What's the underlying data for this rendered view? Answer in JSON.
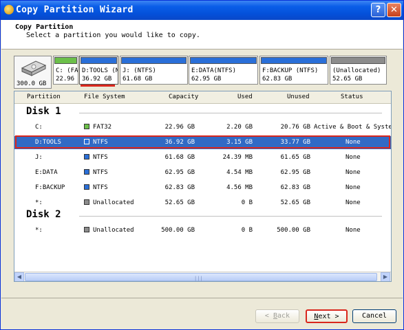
{
  "window": {
    "title": "Copy Partition Wizard"
  },
  "header": {
    "title": "Copy Partition",
    "subtitle": "Select a partition you would like to copy."
  },
  "disk_map": {
    "disk_size": "300.0 GB",
    "partitions": [
      {
        "name": "C: (FA'",
        "size": "22.96",
        "bar_color": "#6cc04a"
      },
      {
        "name": "D:TOOLS (NT",
        "size": "36.92 GB",
        "bar_color": "#2a6fd8"
      },
      {
        "name": "J: (NTFS)",
        "size": "61.68 GB",
        "bar_color": "#2a6fd8"
      },
      {
        "name": "E:DATA(NTFS)",
        "size": "62.95 GB",
        "bar_color": "#2a6fd8"
      },
      {
        "name": "F:BACKUP (NTFS)",
        "size": "62.83 GB",
        "bar_color": "#2a6fd8"
      },
      {
        "name": "(Unallocated)",
        "size": "52.65 GB",
        "bar_color": "#8c8c8c"
      }
    ]
  },
  "table": {
    "columns": [
      "Partition",
      "File System",
      "Capacity",
      "Used",
      "Unused",
      "Status"
    ],
    "disks": [
      {
        "label": "Disk 1",
        "rows": [
          {
            "partition": "C:",
            "fs": "FAT32",
            "fs_color": "#6cc04a",
            "capacity": "22.96 GB",
            "used": "2.20 GB",
            "unused": "20.76 GB",
            "status": "Active & Boot & Systen"
          },
          {
            "partition": "D:TOOLS",
            "fs": "NTFS",
            "fs_color": "#2a6fd8",
            "capacity": "36.92 GB",
            "used": "3.15 GB",
            "unused": "33.77 GB",
            "status": "None"
          },
          {
            "partition": "J:",
            "fs": "NTFS",
            "fs_color": "#2a6fd8",
            "capacity": "61.68 GB",
            "used": "24.39 MB",
            "unused": "61.65 GB",
            "status": "None"
          },
          {
            "partition": "E:DATA",
            "fs": "NTFS",
            "fs_color": "#2a6fd8",
            "capacity": "62.95 GB",
            "used": "4.54 MB",
            "unused": "62.95 GB",
            "status": "None"
          },
          {
            "partition": "F:BACKUP",
            "fs": "NTFS",
            "fs_color": "#2a6fd8",
            "capacity": "62.83 GB",
            "used": "4.56 MB",
            "unused": "62.83 GB",
            "status": "None"
          },
          {
            "partition": "*:",
            "fs": "Unallocated",
            "fs_color": "#8c8c8c",
            "capacity": "52.65 GB",
            "used": "0 B",
            "unused": "52.65 GB",
            "status": "None"
          }
        ]
      },
      {
        "label": "Disk 2",
        "rows": [
          {
            "partition": "*:",
            "fs": "Unallocated",
            "fs_color": "#8c8c8c",
            "capacity": "500.00 GB",
            "used": "0 B",
            "unused": "500.00 GB",
            "status": "None"
          }
        ]
      }
    ]
  },
  "buttons": {
    "back_key": "B",
    "back_rest": "ack",
    "back_prefix": "< ",
    "next_key": "N",
    "next_rest": "ext >",
    "cancel": "Cancel"
  },
  "colors": {
    "selection": "#316ac5",
    "highlight_frame": "#d9261c",
    "titlebar": "#0450d9"
  }
}
